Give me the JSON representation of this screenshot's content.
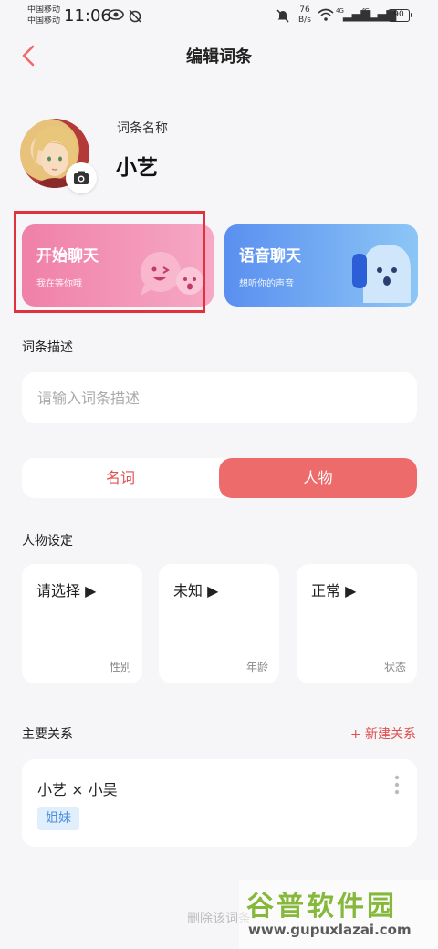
{
  "status_bar": {
    "carrier_1": "中国移动",
    "carrier_2": "中国移动",
    "time": "11:06",
    "net_speed_value": "76",
    "net_speed_unit": "B/s",
    "signal_1": "4G",
    "signal_2": "4G",
    "battery": "90"
  },
  "header": {
    "title": "编辑词条"
  },
  "entry": {
    "name_label": "词条名称",
    "name": "小艺"
  },
  "cards": {
    "chat": {
      "title": "开始聊天",
      "subtitle": "我在等你哦"
    },
    "voice": {
      "title": "语音聊天",
      "subtitle": "想听你的声音"
    }
  },
  "description": {
    "label": "词条描述",
    "placeholder": "请输入词条描述"
  },
  "type_toggle": {
    "noun": "名词",
    "person": "人物",
    "selected": "人物"
  },
  "settings": {
    "label": "人物设定",
    "items": [
      {
        "value": "请选择 ▶",
        "caption": "性别"
      },
      {
        "value": "未知 ▶",
        "caption": "年龄"
      },
      {
        "value": "正常 ▶",
        "caption": "状态"
      }
    ]
  },
  "relations": {
    "label": "主要关系",
    "new_button": "+ 新建关系",
    "items": [
      {
        "names": "小艺 × 小吴",
        "tag": "姐妹"
      }
    ]
  },
  "delete_button": "删除该词条",
  "watermark": {
    "title": "谷普软件园",
    "url": "www.gupuxlazai.com"
  },
  "colors": {
    "accent": "#ee6b6b",
    "highlight_box": "#e0323c",
    "chat_card": "#f080a8",
    "voice_card": "#5a8ff0"
  }
}
